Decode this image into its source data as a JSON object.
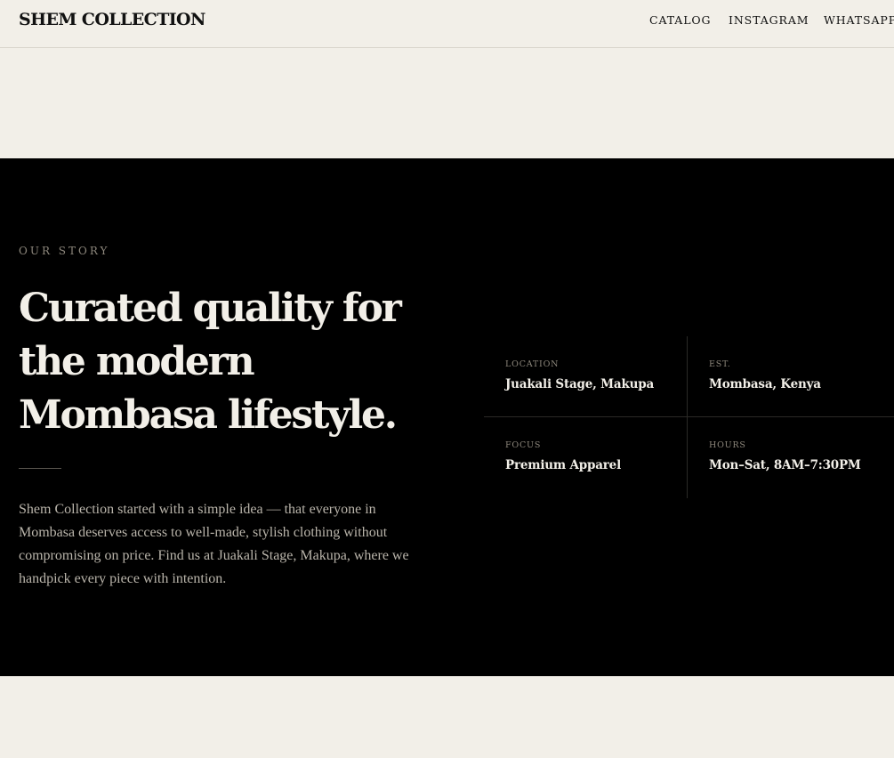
{
  "header": {
    "brand": "SHEM COLLECTION",
    "nav": {
      "catalog": "CATALOG",
      "instagram": "INSTAGRAM",
      "whatsapp": "WHATSAPP"
    }
  },
  "story": {
    "eyebrow": "OUR STORY",
    "headline": "Curated quality for the modern Mombasa lifestyle.",
    "body": "Shem Collection started with a simple idea — that everyone in Mombasa deserves access to well-made, stylish clothing without compromising on price. Find us at Juakali Stage, Makupa, where we handpick every piece with intention.",
    "facts": [
      {
        "label": "LOCATION",
        "value": "Juakali Stage, Makupa"
      },
      {
        "label": "EST.",
        "value": "Mombasa, Kenya"
      },
      {
        "label": "FOCUS",
        "value": "Premium Apparel"
      },
      {
        "label": "HOURS",
        "value": "Mon–Sat, 8AM–7:30PM"
      }
    ]
  },
  "colors": {
    "background": "#f2efe8",
    "dark_section": "#000000",
    "muted_text": "#8d877c",
    "light_text": "#f2efe8"
  }
}
